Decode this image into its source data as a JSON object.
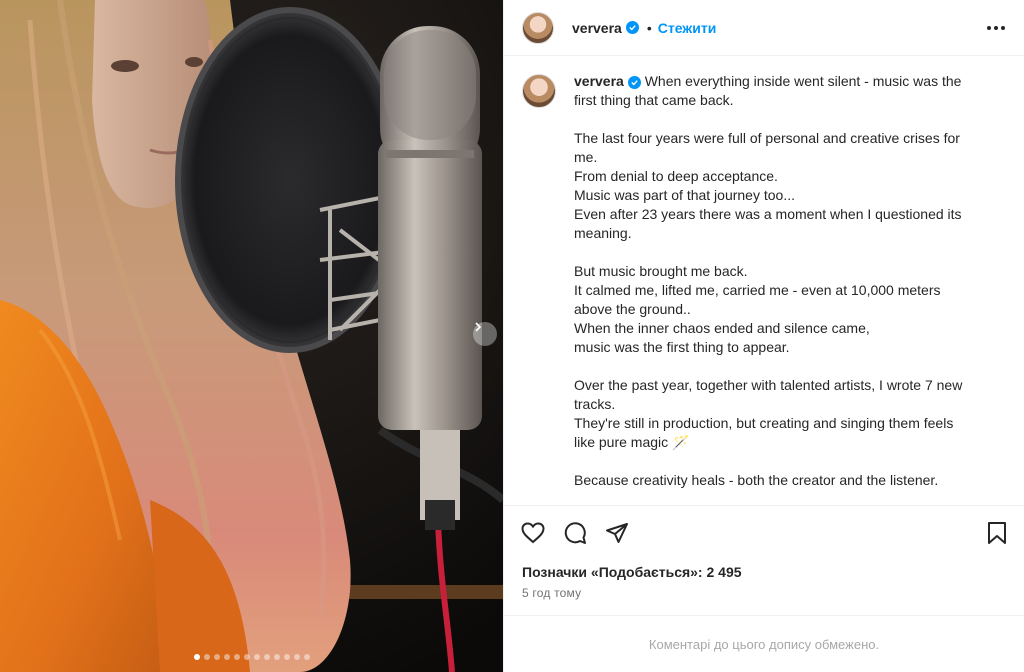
{
  "post": {
    "username": "ververa",
    "follow_separator": "•",
    "follow_label": "Стежити",
    "caption_lines": [
      "When everything inside went silent - music was the",
      "first thing that came back.",
      "",
      "The last four years were full of personal and creative crises for",
      "me.",
      "From denial to deep acceptance.",
      "Music was part of that journey too...",
      "Even after 23 years there was a moment when I questioned its",
      "meaning.",
      "",
      "But music brought me back.",
      "It calmed me, lifted me, carried me - even at 10,000 meters",
      "above the ground..",
      "When the inner chaos ended and silence came,",
      "music was the first thing to appear.",
      "",
      "Over the past year, together with talented artists, I wrote 7 new",
      "tracks.",
      "They're still in production, but creating and singing them feels",
      "like pure magic 🪄",
      "",
      "Because creativity heals - both the creator and the listener."
    ],
    "likes_text": "Позначки «Подобається»: 2 495",
    "time_text": "5 год тому",
    "comments_disabled_text": "Коментарі до цього допису обмежено."
  },
  "carousel": {
    "total": 12,
    "active_index": 0
  },
  "icons": {
    "verified": "verified-badge-icon",
    "more": "more-horizontal-icon",
    "like": "heart-icon",
    "comment": "comment-icon",
    "share": "share-icon",
    "save": "bookmark-icon",
    "next": "chevron-right-icon"
  },
  "colors": {
    "link_blue": "#0095f6",
    "text": "#262626",
    "muted": "#737373",
    "sweater_orange": "#e8781c"
  }
}
